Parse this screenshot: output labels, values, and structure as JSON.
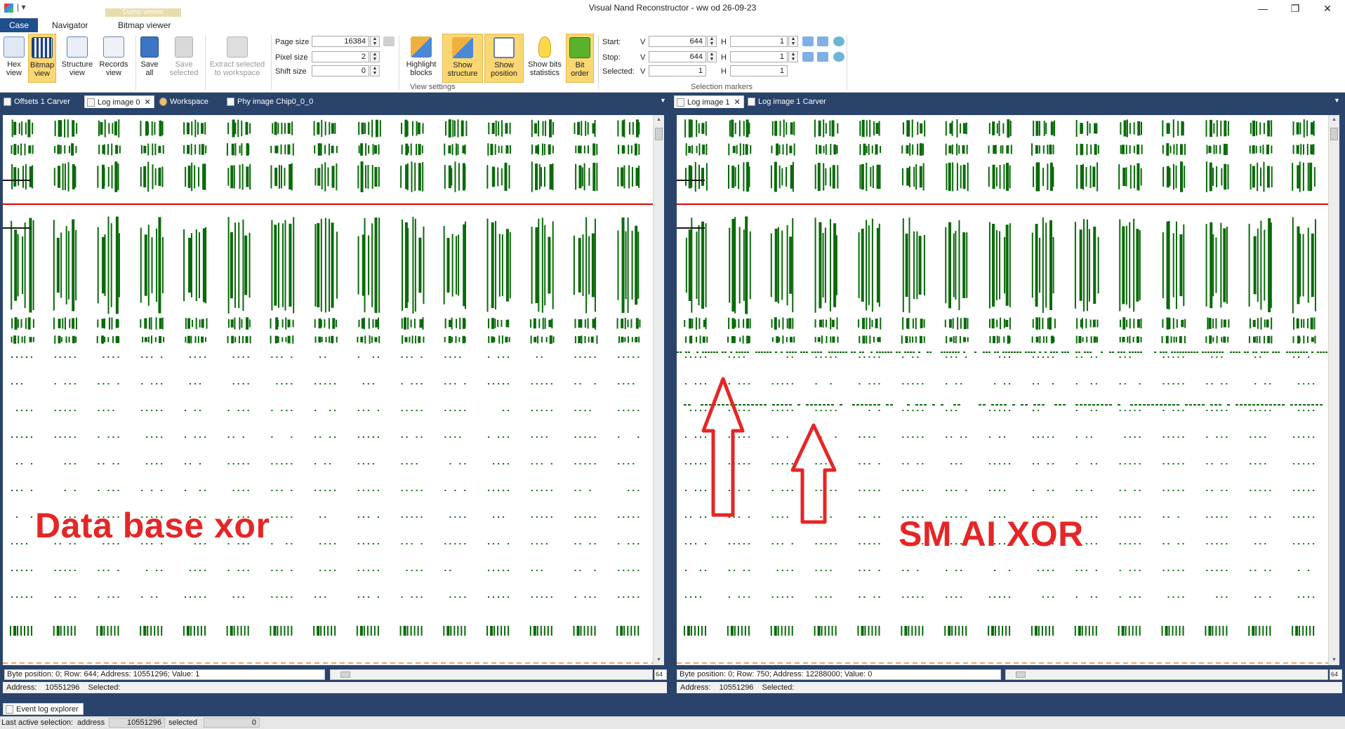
{
  "window": {
    "title": "Visual Nand Reconstructor - ww od 26-09-23",
    "quick_access": "| ▾",
    "minimize": "—",
    "restore": "❐",
    "close": "✕"
  },
  "ribbon_tabs": {
    "case": "Case",
    "navigator": "Navigator",
    "bitmap_viewer": "Bitmap viewer",
    "context_header": "Dump viewer"
  },
  "ribbon": {
    "hex_view": [
      "Hex",
      "view"
    ],
    "bitmap_view": [
      "Bitmap",
      "view"
    ],
    "structure_view": [
      "Structure",
      "view"
    ],
    "records_view": [
      "Records",
      "view"
    ],
    "save_all": [
      "Save",
      "all"
    ],
    "save_selected": [
      "Save",
      "selected"
    ],
    "extract_selected": [
      "Extract selected",
      "to workspace"
    ],
    "page_size_label": "Page size",
    "page_size_value": "16384",
    "pixel_size_label": "Pixel size",
    "pixel_size_value": "2",
    "shift_size_label": "Shift size",
    "shift_size_value": "0",
    "highlight_blocks": [
      "Highlight",
      "blocks"
    ],
    "show_structure": [
      "Show",
      "structure"
    ],
    "show_position": [
      "Show",
      "position"
    ],
    "show_bits_statistics": [
      "Show bits",
      "statistics"
    ],
    "bit_order": [
      "Bit",
      "order"
    ],
    "view_settings_group": "View settings",
    "start_label": "Start:",
    "stop_label": "Stop:",
    "selected_label": "Selected:",
    "v_letter": "V",
    "h_letter": "H",
    "start_v": "644",
    "start_h": "1",
    "stop_v": "644",
    "stop_h": "1",
    "selected_v": "1",
    "selected_h": "1",
    "selection_markers_group": "Selection markers"
  },
  "left_pane": {
    "tabs": [
      "Offsets 1 Carver",
      "Log image 0",
      "Workspace",
      "Phy image Chip0_0_0"
    ],
    "active_tab": 1,
    "status_line": "Byte position: 0; Row: 644; Address: 10551296; Value: 1",
    "address_label": "Address:",
    "address_value": "10551296",
    "selected_label": "Selected:",
    "annotation": "Data base xor",
    "corner": "64"
  },
  "right_pane": {
    "tabs": [
      "Log image 1",
      "Log image 1 Carver"
    ],
    "active_tab": 0,
    "status_line": "Byte position: 0; Row: 750; Address: 12288000; Value: 0",
    "address_label": "Address:",
    "address_value": "10551296",
    "selected_label": "Selected:",
    "annotation": "SM AI XOR",
    "corner": "64"
  },
  "event_log": {
    "tab": "Event log explorer"
  },
  "statusbar": {
    "last_active": "Last active selection:",
    "address_label": "address",
    "address_value": "10551296",
    "selected_label": "selected",
    "selected_value": "0"
  },
  "colors": {
    "accent": "#1f4e8c",
    "ribbon_active": "#fbd774",
    "bitmap_green": "#0a6a0a",
    "marker_red": "#e00000",
    "annotation_red": "#e52626",
    "pane_background": "#29436b"
  }
}
